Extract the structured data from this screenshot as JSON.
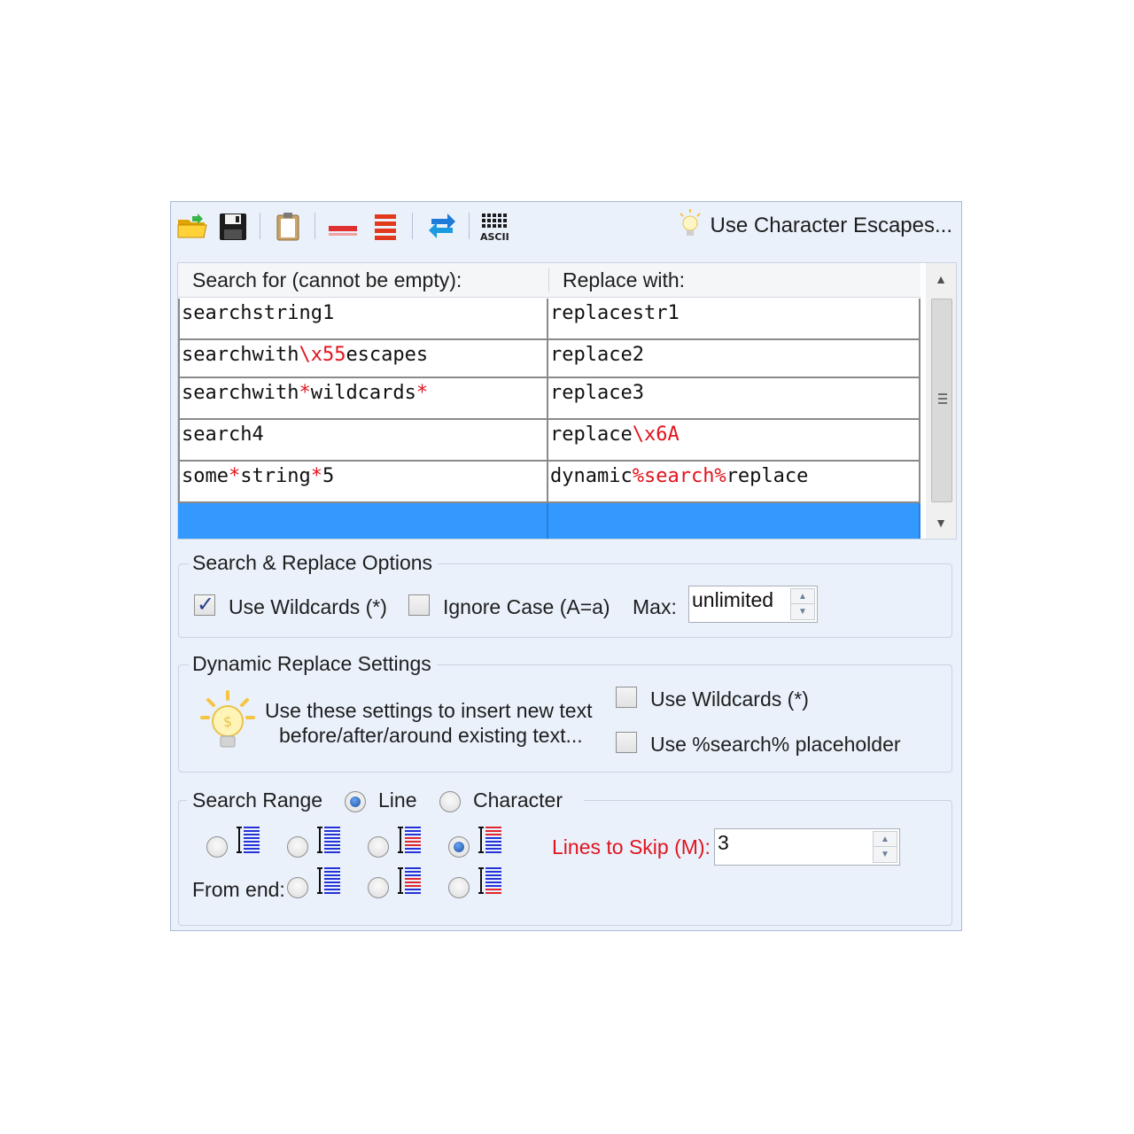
{
  "toolbar": {
    "buttons": [
      {
        "name": "open-folder-icon"
      },
      {
        "name": "save-disk-icon"
      },
      {
        "name": "clipboard-icon"
      },
      {
        "name": "delete-row-icon"
      },
      {
        "name": "delete-all-rows-icon"
      },
      {
        "name": "swap-arrows-icon"
      },
      {
        "name": "ascii-table-icon"
      }
    ],
    "escapes_link": "Use Character Escapes..."
  },
  "grid": {
    "headers": [
      "Search for (cannot be empty):",
      "Replace with:"
    ],
    "rows": [
      {
        "search": [
          {
            "t": "searchstring1"
          }
        ],
        "replace": [
          {
            "t": "replacestr1"
          }
        ]
      },
      {
        "search": [
          {
            "t": "searchwith"
          },
          {
            "t": "\\x55",
            "red": true
          },
          {
            "t": "escapes"
          }
        ],
        "replace": [
          {
            "t": "replace2"
          }
        ]
      },
      {
        "search": [
          {
            "t": "searchwith"
          },
          {
            "t": "*",
            "red": true
          },
          {
            "t": "wildcards"
          },
          {
            "t": "*",
            "red": true
          }
        ],
        "replace": [
          {
            "t": "replace3"
          }
        ]
      },
      {
        "search": [
          {
            "t": "search4"
          }
        ],
        "replace": [
          {
            "t": "replace"
          },
          {
            "t": "\\x6A",
            "red": true
          }
        ]
      },
      {
        "search": [
          {
            "t": "some"
          },
          {
            "t": "*",
            "red": true
          },
          {
            "t": "string"
          },
          {
            "t": "*",
            "red": true
          },
          {
            "t": "5"
          }
        ],
        "replace": [
          {
            "t": "dynamic"
          },
          {
            "t": "%search%",
            "red": true
          },
          {
            "t": "replace"
          }
        ]
      },
      {
        "search": [],
        "replace": [],
        "selected": true
      }
    ]
  },
  "options": {
    "title": "Search & Replace Options",
    "use_wildcards": {
      "label": "Use Wildcards (*)",
      "checked": true
    },
    "ignore_case": {
      "label": "Ignore Case (A=a)",
      "checked": false
    },
    "max_label": "Max:",
    "max_value": "unlimited"
  },
  "dynamic": {
    "title": "Dynamic Replace Settings",
    "hint_line1": "Use these settings to insert new text",
    "hint_line2": "before/after/around existing text...",
    "use_wildcards": {
      "label": "Use Wildcards (*)",
      "checked": false
    },
    "use_placeholder": {
      "label": "Use %search% placeholder",
      "checked": false
    }
  },
  "range": {
    "title": "Search Range",
    "mode_line": {
      "label": "Line",
      "selected": true
    },
    "mode_char": {
      "label": "Character",
      "selected": false
    },
    "lines_to_skip_label": "Lines to Skip (M):",
    "lines_to_skip_value": "3",
    "from_end_label": "From end:",
    "selected_option": 4,
    "label_color": "#e0141e"
  }
}
